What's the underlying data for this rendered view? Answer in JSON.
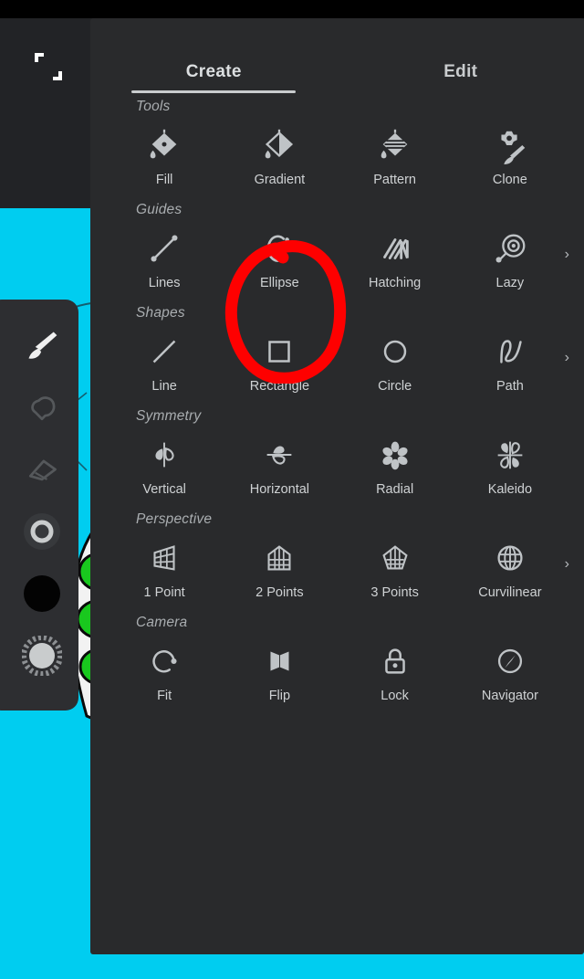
{
  "app": {
    "canvas_color": "#00cdf0",
    "panel_color": "#292a2c",
    "annotation_color": "#fe0000"
  },
  "canvas": {
    "crop_icon": "crop-corners-icon",
    "artwork": "pea-pod-drawing"
  },
  "tool_rail": {
    "items": [
      {
        "name": "brush-tool",
        "icon": "paintbrush-icon",
        "active": true
      },
      {
        "name": "smudge-tool",
        "icon": "smudge-hand-icon",
        "active": false
      },
      {
        "name": "eraser-tool",
        "icon": "eraser-icon",
        "active": false
      },
      {
        "name": "brush-size-tool",
        "icon": "circle-ring-icon",
        "active": false
      },
      {
        "name": "color-swatch",
        "icon": "filled-circle-icon",
        "active": false
      },
      {
        "name": "opacity-tool",
        "icon": "dotted-circle-icon",
        "active": false
      }
    ]
  },
  "panel": {
    "tabs": [
      {
        "label": "Create",
        "active": true
      },
      {
        "label": "Edit",
        "active": false
      }
    ],
    "sections": [
      {
        "title": "Tools",
        "has_more": false,
        "items": [
          {
            "label": "Fill",
            "icon": "fill-bucket-icon"
          },
          {
            "label": "Gradient",
            "icon": "gradient-icon"
          },
          {
            "label": "Pattern",
            "icon": "pattern-icon"
          },
          {
            "label": "Clone",
            "icon": "clone-stamp-icon"
          }
        ]
      },
      {
        "title": "Guides",
        "has_more": true,
        "items": [
          {
            "label": "Lines",
            "icon": "line-guide-icon"
          },
          {
            "label": "Ellipse",
            "icon": "ellipse-guide-icon",
            "annotated": true
          },
          {
            "label": "Hatching",
            "icon": "hatching-icon"
          },
          {
            "label": "Lazy",
            "icon": "lazy-mouse-icon"
          }
        ]
      },
      {
        "title": "Shapes",
        "has_more": true,
        "items": [
          {
            "label": "Line",
            "icon": "line-icon"
          },
          {
            "label": "Rectangle",
            "icon": "rectangle-icon"
          },
          {
            "label": "Circle",
            "icon": "circle-icon"
          },
          {
            "label": "Path",
            "icon": "path-curve-icon"
          }
        ]
      },
      {
        "title": "Symmetry",
        "has_more": false,
        "items": [
          {
            "label": "Vertical",
            "icon": "vertical-symmetry-icon"
          },
          {
            "label": "Horizontal",
            "icon": "horizontal-symmetry-icon"
          },
          {
            "label": "Radial",
            "icon": "radial-symmetry-icon"
          },
          {
            "label": "Kaleido",
            "icon": "kaleido-symmetry-icon"
          }
        ]
      },
      {
        "title": "Perspective",
        "has_more": true,
        "items": [
          {
            "label": "1 Point",
            "icon": "one-point-perspective-icon"
          },
          {
            "label": "2 Points",
            "icon": "two-point-perspective-icon"
          },
          {
            "label": "3 Points",
            "icon": "three-point-perspective-icon"
          },
          {
            "label": "Curvilinear",
            "icon": "curvilinear-perspective-icon"
          }
        ]
      },
      {
        "title": "Camera",
        "has_more": false,
        "items": [
          {
            "label": "Fit",
            "icon": "fit-icon"
          },
          {
            "label": "Flip",
            "icon": "flip-icon"
          },
          {
            "label": "Lock",
            "icon": "lock-icon"
          },
          {
            "label": "Navigator",
            "icon": "navigator-compass-icon"
          }
        ]
      }
    ],
    "more_indicator": "›"
  }
}
